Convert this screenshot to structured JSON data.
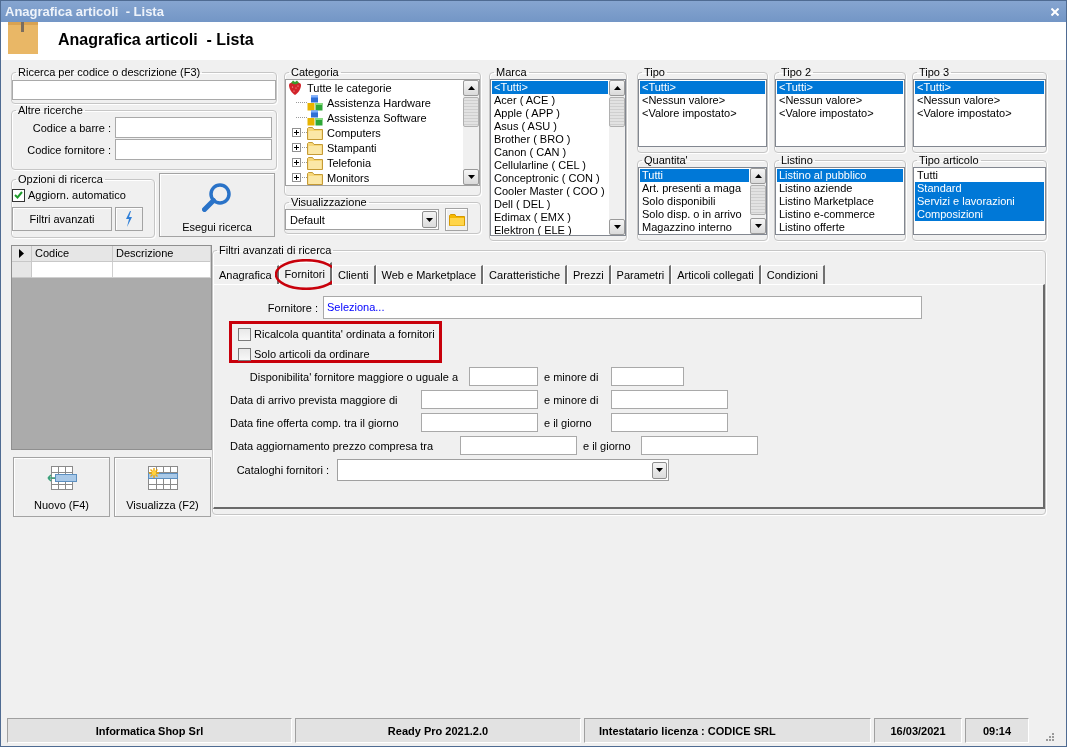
{
  "window": {
    "title": "Anagrafica articoli  - Lista"
  },
  "header": {
    "title": "Anagrafica articoli  - Lista"
  },
  "search": {
    "label": "Ricerca per codice o descrizione (F3)"
  },
  "other_searches": {
    "label": "Altre ricerche",
    "fields": [
      {
        "label": "Codice a barre :"
      },
      {
        "label": "Codice fornitore :"
      }
    ]
  },
  "search_options": {
    "label": "Opzioni di ricerca",
    "auto_update": {
      "label": "Aggiorn. automatico",
      "checked": true
    },
    "advanced_button": "Filtri avanzati"
  },
  "run_button": "Esegui ricerca",
  "category": {
    "label": "Categoria",
    "items": [
      {
        "label": "Tutte le categorie",
        "kind": "root",
        "children": [
          {
            "label": "Assistenza Hardware",
            "kind": "service"
          },
          {
            "label": "Assistenza Software",
            "kind": "service"
          },
          {
            "label": "Computers",
            "kind": "folder",
            "expanded": false
          },
          {
            "label": "Stampanti",
            "kind": "folder",
            "expanded": false
          },
          {
            "label": "Telefonia",
            "kind": "folder",
            "expanded": false
          },
          {
            "label": "Monitors",
            "kind": "folder",
            "expanded": false
          }
        ]
      }
    ]
  },
  "view": {
    "label": "Visualizzazione",
    "value": "Default"
  },
  "brand": {
    "label": "Marca",
    "items": [
      {
        "label": "<Tutti>",
        "selected": true
      },
      {
        "label": "Acer ( ACE )",
        "selected": false
      },
      {
        "label": "Apple ( APP )",
        "selected": false
      },
      {
        "label": "Asus ( ASU )",
        "selected": false
      },
      {
        "label": "Brother ( BRO )",
        "selected": false
      },
      {
        "label": "Canon ( CAN )",
        "selected": false
      },
      {
        "label": "Cellularline ( CEL )",
        "selected": false
      },
      {
        "label": "Conceptronic ( CON )",
        "selected": false
      },
      {
        "label": "Cooler Master ( COO )",
        "selected": false
      },
      {
        "label": "Dell ( DEL )",
        "selected": false
      },
      {
        "label": "Edimax ( EMX )",
        "selected": false
      },
      {
        "label": "Elektron ( ELE )",
        "selected": false
      }
    ]
  },
  "type": {
    "label": "Tipo",
    "items": [
      {
        "label": "<Tutti>",
        "selected": true
      },
      {
        "label": "<Nessun valore>",
        "selected": false
      },
      {
        "label": "<Valore impostato>",
        "selected": false
      }
    ]
  },
  "type_2": {
    "label": "Tipo 2",
    "items": [
      {
        "label": "<Tutti>",
        "selected": true
      },
      {
        "label": "<Nessun valore>",
        "selected": false
      },
      {
        "label": "<Valore impostato>",
        "selected": false
      }
    ]
  },
  "type_3": {
    "label": "Tipo 3",
    "items": [
      {
        "label": "<Tutti>",
        "selected": true
      },
      {
        "label": "<Nessun valore>",
        "selected": false
      },
      {
        "label": "<Valore impostato>",
        "selected": false
      }
    ]
  },
  "quantity": {
    "label": "Quantita'",
    "items": [
      {
        "label": "Tutti",
        "selected": true
      },
      {
        "label": "Art. presenti a maga",
        "selected": false
      },
      {
        "label": "Solo disponibili",
        "selected": false
      },
      {
        "label": "Solo disp. o in arrivo",
        "selected": false
      },
      {
        "label": "Magazzino interno",
        "selected": false
      }
    ]
  },
  "price_list": {
    "label": "Listino",
    "items": [
      {
        "label": "Listino al pubblico",
        "selected": true
      },
      {
        "label": "Listino aziende",
        "selected": false
      },
      {
        "label": "Listino Marketplace",
        "selected": false
      },
      {
        "label": "Listino e-commerce",
        "selected": false
      },
      {
        "label": "Listino offerte",
        "selected": false
      }
    ]
  },
  "article_type": {
    "label": "Tipo articolo",
    "items": [
      {
        "label": "Tutti",
        "selected": false
      },
      {
        "label": "Standard",
        "selected": true
      },
      {
        "label": "Servizi e lavorazioni",
        "selected": true
      },
      {
        "label": "Composizioni",
        "selected": true
      }
    ]
  },
  "results_grid": {
    "columns": [
      "Codice",
      "Descrizione"
    ]
  },
  "actions": [
    {
      "label": "Nuovo (F4)",
      "kind": "new"
    },
    {
      "label": "Visualizza (F2)",
      "kind": "view"
    }
  ],
  "advanced_filters": {
    "label": "Filtri avanzati di ricerca",
    "tabs": [
      {
        "label": "Anagrafica",
        "selected": false,
        "circled": false
      },
      {
        "label": "Fornitori",
        "selected": true,
        "circled": true
      },
      {
        "label": "Clienti",
        "selected": false,
        "circled": false
      },
      {
        "label": "Web e Marketplace",
        "selected": false,
        "circled": false
      },
      {
        "label": "Caratteristiche",
        "selected": false,
        "circled": false
      },
      {
        "label": "Prezzi",
        "selected": false,
        "circled": false
      },
      {
        "label": "Parametri",
        "selected": false,
        "circled": false
      },
      {
        "label": "Articoli collegati",
        "selected": false,
        "circled": false
      },
      {
        "label": "Condizioni",
        "selected": false,
        "circled": false
      }
    ],
    "supplier": {
      "label": "Fornitore :",
      "value": "Seleziona..."
    },
    "options": {
      "highlighted": true,
      "items": [
        {
          "label": "Ricalcola quantita' ordinata a fornitori",
          "checked": false
        },
        {
          "label": "Solo articoli da ordinare",
          "checked": false
        }
      ]
    },
    "ranges": [
      {
        "label": "Disponibilita' fornitore maggiore o uguale a",
        "between": "e minore di",
        "kind": "qty"
      },
      {
        "label": "Data di arrivo prevista maggiore di",
        "between": "e minore di",
        "kind": "date"
      },
      {
        "label": "Data fine offerta comp. tra il giorno",
        "between": "e il giorno",
        "kind": "date"
      },
      {
        "label": "Data aggiornamento prezzo compresa tra",
        "between": "e il giorno",
        "kind": "date-wide"
      }
    ],
    "catalogs": {
      "label": "Cataloghi fornitori :"
    }
  },
  "status_bar": {
    "company": "Informatica Shop Srl",
    "version": "Ready Pro 2021.2.0",
    "license": "Intestatario licenza : CODICE SRL",
    "date": "16/03/2021",
    "time": "09:14"
  }
}
